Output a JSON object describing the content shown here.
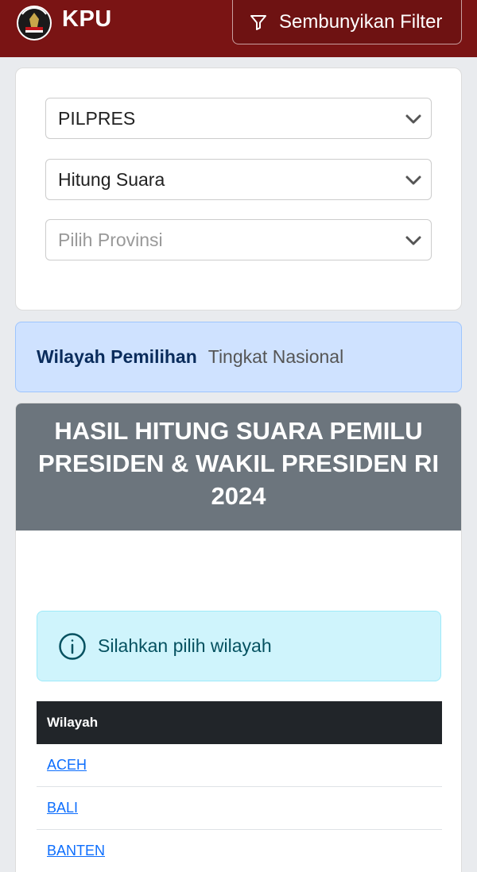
{
  "navbar": {
    "brand": "KPU",
    "filter_button_label": "Sembunyikan Filter",
    "accent_color": "#7a1414"
  },
  "filters": {
    "election_type": "PILPRES",
    "mode": "Hitung Suara",
    "province_placeholder": "Pilih Provinsi"
  },
  "wilayah": {
    "label": "Wilayah Pemilihan",
    "value": "Tingkat Nasional"
  },
  "result": {
    "title_line1": "HASIL HITUNG SUARA PEMILU",
    "title_line2": "PRESIDEN & WAKIL PRESIDEN RI",
    "title_line3": "2024",
    "info_message": "Silahkan pilih wilayah"
  },
  "table": {
    "header": "Wilayah",
    "rows": [
      "ACEH",
      "BALI",
      "BANTEN"
    ]
  }
}
